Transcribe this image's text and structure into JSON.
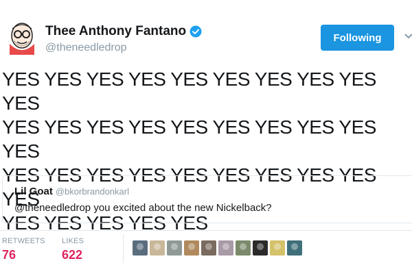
{
  "author": {
    "name": "Thee Anthony Fantano",
    "handle": "@theneedledrop",
    "verified": true,
    "avatar_icon": "cartoon-face-avatar"
  },
  "follow_button": {
    "label": "Following",
    "color": "#1b95e0"
  },
  "tweet": {
    "text": "YES YES YES YES YES YES YES YES YES YES\nYES YES YES YES YES YES YES YES YES YES\nYES YES YES YES YES YES YES YES YES YES\nYES YES YES YES YES"
  },
  "quoted_tweet": {
    "name": "Lil Goat",
    "handle": "@bkorbrandonkarl",
    "text": "@theneedledrop you excited about the new Nickelback?"
  },
  "stats": {
    "retweets_label": "RETWEETS",
    "retweets_count": "76",
    "likes_label": "LIKES",
    "likes_count": "622",
    "count_color": "#e0245e"
  },
  "likers": [
    {
      "color": "#5a6d7e",
      "name": "liker-avatar"
    },
    {
      "color": "#c8b79a",
      "name": "liker-avatar"
    },
    {
      "color": "#8f9a96",
      "name": "liker-avatar"
    },
    {
      "color": "#b08a5e",
      "name": "liker-avatar"
    },
    {
      "color": "#7a6b5e",
      "name": "liker-avatar"
    },
    {
      "color": "#a89aa6",
      "name": "liker-avatar"
    },
    {
      "color": "#7b8a6a",
      "name": "liker-avatar"
    },
    {
      "color": "#2b2b2b",
      "name": "liker-avatar"
    },
    {
      "color": "#d4c26a",
      "name": "liker-avatar"
    },
    {
      "color": "#3f6f7a",
      "name": "liker-avatar"
    }
  ]
}
